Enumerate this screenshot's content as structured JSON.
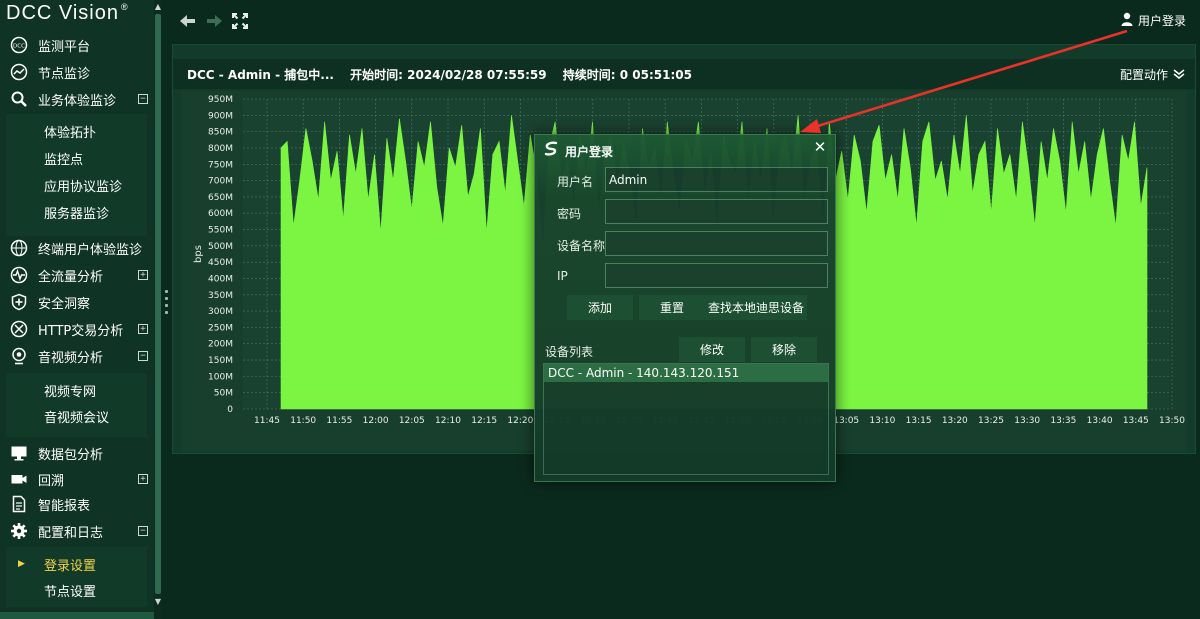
{
  "brand": {
    "logo_text": "DCC Vision",
    "reg_mark": "®"
  },
  "sidebar": {
    "items": [
      {
        "label": "监测平台",
        "icon": "dcc-icon",
        "expander": ""
      },
      {
        "label": "节点监诊",
        "icon": "trend-icon",
        "expander": ""
      },
      {
        "label": "业务体验监诊",
        "icon": "magnifier-icon",
        "expander": "⊟"
      },
      {
        "label": "终端用户体验监诊",
        "icon": "globe-icon",
        "expander": ""
      },
      {
        "label": "全流量分析",
        "icon": "pulse-icon",
        "expander": "⊞"
      },
      {
        "label": "安全洞察",
        "icon": "shield-icon",
        "expander": ""
      },
      {
        "label": "HTTP交易分析",
        "icon": "http-icon",
        "expander": "⊞"
      },
      {
        "label": "音视频分析",
        "icon": "webcam-icon",
        "expander": "⊟"
      },
      {
        "label": "数据包分析",
        "icon": "monitor-icon",
        "expander": ""
      },
      {
        "label": "回溯",
        "icon": "camera-icon",
        "expander": "⊞"
      },
      {
        "label": "智能报表",
        "icon": "report-icon",
        "expander": ""
      },
      {
        "label": "配置和日志",
        "icon": "gear-icon",
        "expander": "⊟"
      }
    ],
    "sub_business": [
      "体验拓扑",
      "监控点",
      "应用协议监诊",
      "服务器监诊"
    ],
    "sub_av": [
      "视频专网",
      "音视频会议"
    ],
    "sub_config": [
      "登录设置",
      "节点设置"
    ]
  },
  "topbar": {
    "user_login_label": "用户登录"
  },
  "panel": {
    "title_parts": [
      "DCC - Admin - 捕包中...",
      "开始时间: 2024/02/28 07:55:59",
      "持续时间: 0 05:51:05"
    ],
    "config_action_label": "配置动作"
  },
  "chart_data": {
    "type": "area",
    "ylabel": "bps",
    "y_ticks": [
      "0",
      "50M",
      "100M",
      "150M",
      "200M",
      "250M",
      "300M",
      "350M",
      "400M",
      "450M",
      "500M",
      "550M",
      "600M",
      "650M",
      "700M",
      "750M",
      "800M",
      "850M",
      "900M",
      "950M"
    ],
    "ylim": [
      0,
      950
    ],
    "y_unit": "M",
    "x_ticks": [
      "11:45",
      "11:50",
      "11:55",
      "12:00",
      "12:05",
      "12:10",
      "12:15",
      "12:20",
      "12:25",
      "12:30",
      "12:35",
      "12:40",
      "12:45",
      "12:50",
      "12:55",
      "13:00",
      "13:05",
      "13:10",
      "13:15",
      "13:20",
      "13:25",
      "13:30",
      "13:35",
      "13:40",
      "13:45",
      "13:50"
    ],
    "series_color": "#7cf542",
    "grid": true,
    "series": [
      {
        "values": [
          800,
          820,
          560,
          700,
          860,
          760,
          640,
          880,
          700,
          790,
          580,
          840,
          720,
          860,
          640,
          780,
          540,
          830,
          700,
          890,
          760,
          610,
          820,
          740,
          880,
          680,
          560,
          800,
          740,
          870,
          650,
          720,
          860,
          540,
          780,
          820,
          660,
          900,
          760,
          620,
          840,
          730,
          500,
          800,
          880,
          700,
          760,
          620,
          840,
          720,
          880,
          600,
          780,
          840,
          690,
          820,
          720,
          560,
          860,
          740,
          800,
          640,
          880,
          720,
          600,
          830,
          760,
          880,
          660,
          790,
          540,
          840,
          760,
          720,
          880,
          640,
          820,
          700,
          860,
          580,
          780,
          840,
          720,
          900,
          640,
          760,
          820,
          560,
          880,
          700,
          790,
          640,
          840,
          760,
          600,
          820,
          870,
          700,
          780,
          640,
          860,
          740,
          560,
          820,
          880,
          700,
          760,
          640,
          840,
          720,
          900,
          660,
          780,
          820,
          600,
          860,
          720,
          780,
          640,
          880,
          740,
          560,
          820,
          700,
          860,
          760,
          600,
          880,
          720,
          820,
          640,
          780,
          860,
          700,
          560,
          840,
          760,
          880,
          620,
          740
        ]
      }
    ]
  },
  "dialog": {
    "title": "用户登录",
    "username_label": "用户名",
    "username_value": "Admin",
    "password_label": "密码",
    "password_value": "",
    "device_name_label": "设备名称",
    "device_name_value": "",
    "ip_label": "IP",
    "ip_value": "",
    "add_label": "添加",
    "reset_label": "重置",
    "find_local_label": "查找本地迪思设备",
    "device_list_label": "设备列表",
    "modify_label": "修改",
    "remove_label": "移除",
    "devices": [
      "DCC - Admin - 140.143.120.151"
    ]
  },
  "colors": {
    "accent_arrow": "#e8322a",
    "fill": "#7cf542",
    "bg": "#0b2a1e"
  }
}
